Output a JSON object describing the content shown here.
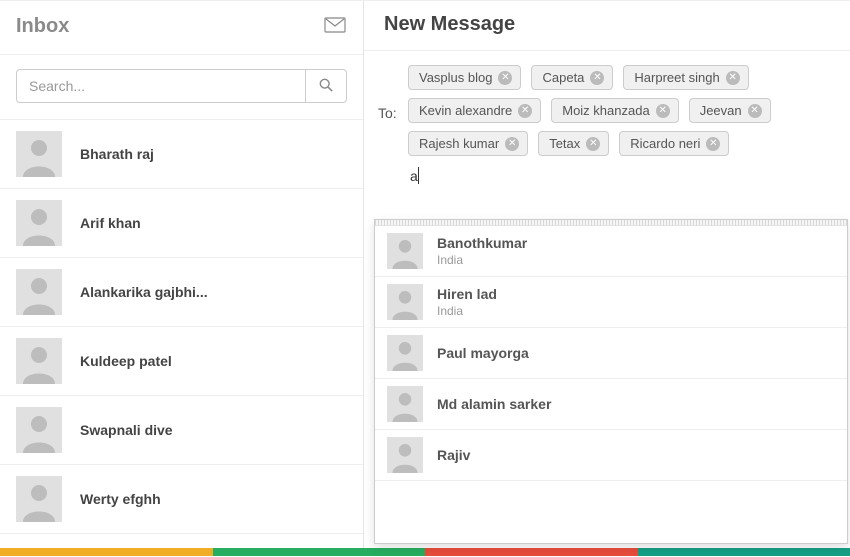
{
  "sidebar": {
    "title": "Inbox",
    "search_placeholder": "Search...",
    "contacts": [
      {
        "name": "Bharath raj"
      },
      {
        "name": "Arif khan"
      },
      {
        "name": "Alankarika gajbhi..."
      },
      {
        "name": "Kuldeep patel"
      },
      {
        "name": "Swapnali dive"
      },
      {
        "name": "Werty efghh"
      }
    ]
  },
  "compose": {
    "title": "New Message",
    "to_label": "To:",
    "chips": [
      "Vasplus blog",
      "Capeta",
      "Harpreet singh",
      "Kevin alexandre",
      "Moiz khanzada",
      "Jeevan",
      "Rajesh kumar",
      "Tetax",
      "Ricardo neri"
    ],
    "input_value": "a",
    "suggestions": [
      {
        "name": "Banothkumar",
        "sub": "India"
      },
      {
        "name": "Hiren lad",
        "sub": "India"
      },
      {
        "name": "Paul mayorga",
        "sub": ""
      },
      {
        "name": "Md alamin sarker",
        "sub": ""
      },
      {
        "name": "Rajiv",
        "sub": ""
      }
    ]
  },
  "bottom_colors": [
    "#f0ad26",
    "#27ae60",
    "#e74c3c",
    "#16a085"
  ]
}
